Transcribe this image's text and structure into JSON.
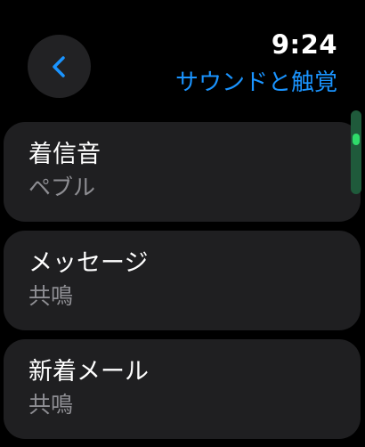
{
  "header": {
    "time": "9:24",
    "title": "サウンドと触覚",
    "back_icon": "chevron-left-icon",
    "accent_color": "#1a94ff"
  },
  "list": {
    "items": [
      {
        "title": "着信音",
        "value": "ペブル"
      },
      {
        "title": "メッセージ",
        "value": "共鳴"
      },
      {
        "title": "新着メール",
        "value": "共鳴"
      }
    ]
  },
  "scroll": {
    "indicator_color": "#2fdb6a"
  }
}
